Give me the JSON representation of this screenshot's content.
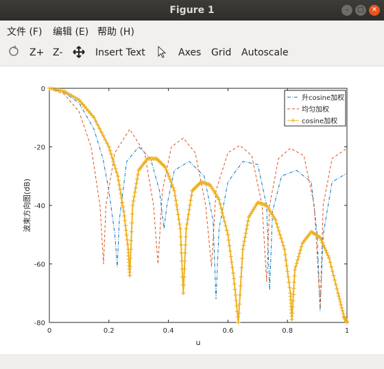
{
  "window": {
    "title": "Figure 1"
  },
  "menu": [
    {
      "label": "文件 (F)"
    },
    {
      "label": "编辑 (E)"
    },
    {
      "label": "帮助 (H)"
    }
  ],
  "toolbar": {
    "z_plus": "Z+",
    "z_minus": "Z-",
    "insert_text": "Insert Text",
    "axes": "Axes",
    "grid": "Grid",
    "autoscale": "Autoscale"
  },
  "chart_data": {
    "type": "line",
    "xlabel": "u",
    "ylabel": "波束方向图(dB)",
    "xlim": [
      0,
      1
    ],
    "ylim": [
      -80,
      0
    ],
    "xticks": [
      0,
      0.2,
      0.4,
      0.6,
      0.8,
      1
    ],
    "yticks": [
      0,
      -20,
      -40,
      -60,
      -80
    ],
    "legend_position": "top-right",
    "series": [
      {
        "name": "升cosine加权",
        "color": "#0072bd",
        "style": "dash-dot",
        "x": [
          0.0,
          0.05,
          0.1,
          0.15,
          0.18,
          0.2,
          0.22,
          0.228,
          0.235,
          0.26,
          0.3,
          0.34,
          0.37,
          0.385,
          0.395,
          0.42,
          0.47,
          0.52,
          0.55,
          0.56,
          0.57,
          0.6,
          0.65,
          0.7,
          0.73,
          0.74,
          0.75,
          0.78,
          0.83,
          0.88,
          0.9,
          0.91,
          0.92,
          0.95,
          1.0
        ],
        "y": [
          0,
          -1.5,
          -5,
          -14,
          -24,
          -35,
          -50,
          -61,
          -45,
          -25,
          -20,
          -24,
          -35,
          -48,
          -40,
          -28,
          -25,
          -30,
          -45,
          -72,
          -48,
          -32,
          -25,
          -26,
          -40,
          -69,
          -42,
          -30,
          -28,
          -32,
          -50,
          -76,
          -50,
          -32,
          -29
        ]
      },
      {
        "name": "均匀加权",
        "color": "#d95319",
        "style": "dash",
        "x": [
          0.0,
          0.05,
          0.1,
          0.14,
          0.17,
          0.182,
          0.19,
          0.22,
          0.27,
          0.32,
          0.35,
          0.365,
          0.38,
          0.41,
          0.45,
          0.49,
          0.525,
          0.545,
          0.56,
          0.6,
          0.64,
          0.68,
          0.715,
          0.73,
          0.74,
          0.77,
          0.81,
          0.855,
          0.89,
          0.91,
          0.92,
          0.95,
          1.0
        ],
        "y": [
          0,
          -2,
          -8,
          -20,
          -40,
          -60,
          -40,
          -22,
          -14,
          -22,
          -40,
          -60,
          -35,
          -20,
          -17,
          -22,
          -40,
          -61,
          -35,
          -22,
          -19.5,
          -23,
          -40,
          -66,
          -40,
          -24,
          -20.5,
          -23,
          -40,
          -75,
          -40,
          -24,
          -20.5
        ]
      },
      {
        "name": "cosine加权",
        "color": "#edb120",
        "style": "solid-plus",
        "x": [
          0.0,
          0.05,
          0.1,
          0.15,
          0.2,
          0.23,
          0.25,
          0.265,
          0.27,
          0.28,
          0.3,
          0.33,
          0.36,
          0.39,
          0.42,
          0.44,
          0.45,
          0.46,
          0.48,
          0.51,
          0.54,
          0.57,
          0.6,
          0.62,
          0.635,
          0.65,
          0.67,
          0.7,
          0.73,
          0.76,
          0.79,
          0.81,
          0.815,
          0.825,
          0.85,
          0.88,
          0.91,
          0.94,
          0.97,
          0.99,
          1.0
        ],
        "y": [
          0,
          -1,
          -4,
          -10,
          -20,
          -30,
          -42,
          -55,
          -64,
          -40,
          -28,
          -24,
          -24,
          -27,
          -35,
          -48,
          -70,
          -48,
          -35,
          -32,
          -33,
          -38,
          -50,
          -65,
          -80,
          -55,
          -44,
          -39,
          -40,
          -45,
          -55,
          -70,
          -79,
          -62,
          -53,
          -49,
          -51,
          -58,
          -70,
          -78,
          -80
        ]
      }
    ]
  }
}
